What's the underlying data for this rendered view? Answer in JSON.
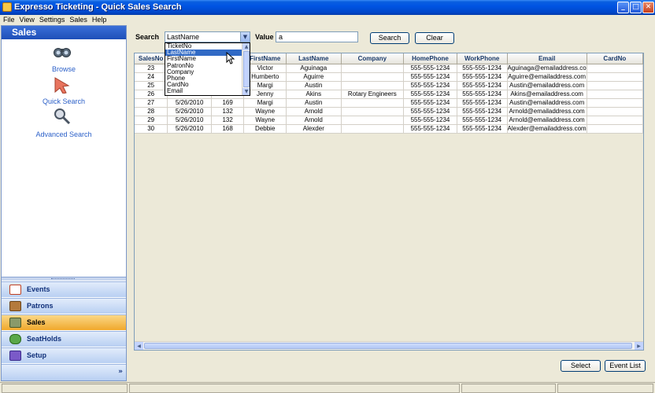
{
  "window": {
    "title": "Expresso Ticketing - Quick Sales Search"
  },
  "menu": [
    "File",
    "View",
    "Settings",
    "Sales",
    "Help"
  ],
  "sidebar": {
    "header": "Sales",
    "links": [
      {
        "label": "Browse",
        "icon": "binoculars-icon"
      },
      {
        "label": "Quick Search",
        "icon": "cursor-arrow-icon"
      },
      {
        "label": "Advanced Search",
        "icon": "magnifier-icon"
      }
    ],
    "nav_buttons": [
      {
        "label": "Events",
        "icon": "calendar-icon",
        "active": false
      },
      {
        "label": "Patrons",
        "icon": "patrons-icon",
        "active": false
      },
      {
        "label": "Sales",
        "icon": "sales-icon",
        "active": true
      },
      {
        "label": "SeatHolds",
        "icon": "seatholds-icon",
        "active": false
      },
      {
        "label": "Setup",
        "icon": "setup-icon",
        "active": false
      }
    ],
    "expand_label": "»"
  },
  "search": {
    "search_label": "Search",
    "field_selected": "LastName",
    "field_options": [
      "TicketNo",
      "LastName",
      "FirstName",
      "PatronNo",
      "Company",
      "Phone",
      "CardNo",
      "Email"
    ],
    "value_label": "Value",
    "value": "a",
    "search_button": "Search",
    "clear_button": "Clear"
  },
  "grid": {
    "columns": [
      "SalesNo",
      "",
      "",
      "FirstName",
      "LastName",
      "Company",
      "HomePhone",
      "WorkPhone",
      "Email",
      "CardNo"
    ],
    "rows": [
      [
        "23",
        "",
        "",
        "Victor",
        "Aguinaga",
        "",
        "555-555-1234",
        "555-555-1234",
        "Aguinaga@emailaddress.co",
        ""
      ],
      [
        "24",
        "",
        "",
        "Humberto",
        "Aguirre",
        "",
        "555-555-1234",
        "555-555-1234",
        "Aguirre@emailaddress.com",
        ""
      ],
      [
        "25",
        "",
        "",
        "Margi",
        "Austin",
        "",
        "555-555-1234",
        "555-555-1234",
        "Austin@emailaddress.com",
        ""
      ],
      [
        "26",
        "",
        "",
        "Jenny",
        "Akins",
        "Rotary Engineers",
        "555-555-1234",
        "555-555-1234",
        "Akins@emailaddress.com",
        ""
      ],
      [
        "27",
        "5/26/2010",
        "169",
        "Margi",
        "Austin",
        "",
        "555-555-1234",
        "555-555-1234",
        "Austin@emailaddress.com",
        ""
      ],
      [
        "28",
        "5/26/2010",
        "132",
        "Wayne",
        "Arnold",
        "",
        "555-555-1234",
        "555-555-1234",
        "Arnold@emailaddress.com",
        ""
      ],
      [
        "29",
        "5/26/2010",
        "132",
        "Wayne",
        "Arnold",
        "",
        "555-555-1234",
        "555-555-1234",
        "Arnold@emailaddress.com",
        ""
      ],
      [
        "30",
        "5/26/2010",
        "168",
        "Debbie",
        "Alexder",
        "",
        "555-555-1234",
        "555-555-1234",
        "Alexder@emailaddress.com",
        ""
      ]
    ]
  },
  "footer": {
    "select_button": "Select",
    "event_list_button": "Event List"
  },
  "colors": {
    "titlebar": "#0054e3",
    "selection": "#316ac5",
    "active_nav": "#f0a82c",
    "link": "#2a5fc8"
  }
}
